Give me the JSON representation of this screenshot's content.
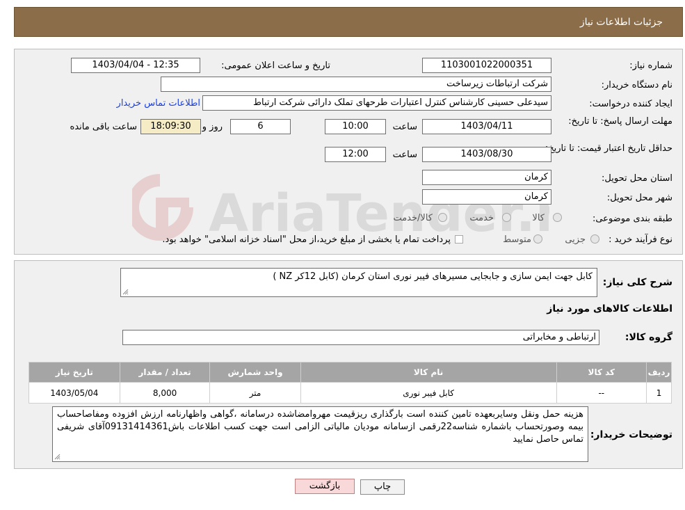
{
  "header": {
    "title": "جزئیات اطلاعات نیاز"
  },
  "form": {
    "need_number_label": "شماره نیاز:",
    "need_number": "1103001022000351",
    "announce_label": "تاریخ و ساعت اعلان عمومی:",
    "announce_value": "1403/04/04 - 12:35",
    "buyer_org_label": "نام دستگاه خریدار:",
    "buyer_org": "شرکت ارتباطات زیرساخت",
    "requester_label": "ایجاد کننده درخواست:",
    "requester": "سیدعلی حسینی کارشناس کنترل اعتبارات طرحهای تملک دارائی شرکت ارتباط",
    "buyer_contact_link": "اطلاعات تماس خریدار",
    "deadline_label": "مهلت ارسال پاسخ: تا تاریخ:",
    "deadline_date": "1403/04/11",
    "time_label": "ساعت",
    "deadline_time": "10:00",
    "days_value": "6",
    "days_label": "روز و",
    "remaining_time": "18:09:30",
    "remaining_label": "ساعت باقی مانده",
    "validity_label": "حداقل تاریخ اعتبار قیمت: تا تاریخ:",
    "validity_date": "1403/08/30",
    "validity_time": "12:00",
    "province_label": "استان محل تحویل:",
    "province": "کرمان",
    "city_label": "شهر محل تحویل:",
    "city": "کرمان",
    "category_label": "طبقه بندی موضوعی:",
    "category_options": [
      "کالا",
      "خدمت",
      "کالا/خدمت"
    ],
    "process_label": "نوع فرآیند خرید :",
    "process_options": [
      "جزیی",
      "متوسط"
    ],
    "payment_note": "پرداخت تمام یا بخشی از مبلغ خرید،از محل \"اسناد خزانه اسلامی\" خواهد بود."
  },
  "summary": {
    "label": "شرح کلی نیاز:",
    "value": "کابل جهت ایمن سازی و جابجایی مسیرهای فیبر نوری استان کرمان (کابل 12کر NZ )"
  },
  "goods_info": {
    "title": "اطلاعات کالاهای مورد نیاز",
    "group_label": "گروه کالا:",
    "group_value": "ارتباطی و مخابراتی"
  },
  "table": {
    "headers": [
      "ردیف",
      "کد کالا",
      "نام کالا",
      "واحد شمارش",
      "تعداد / مقدار",
      "تاریخ نیاز"
    ],
    "rows": [
      [
        "1",
        "--",
        "کابل فیبر نوری",
        "متر",
        "8,000",
        "1403/05/04"
      ]
    ]
  },
  "notes": {
    "label": "توضیحات خریدار:",
    "value": "هزینه حمل ونقل وسایربعهده تامین کننده است بارگذاری ریزقیمت مهروامضاشده درسامانه ،گواهی واظهارنامه ارزش افزوده ومفاصاحساب بیمه وصورتحساب باشماره شناسه22رقمی ازسامانه مودیان مالیاتی الزامی است جهت کسب اطلاعات باش09131414361آقای شریفی تماس حاصل نمایید"
  },
  "buttons": {
    "print": "چاپ",
    "back": "بازگشت"
  },
  "watermark": {
    "text": "AriaTender.neT"
  },
  "colors": {
    "header_bg": "#8c6d4a",
    "table_header_bg": "#a5a5a5",
    "link": "#1a3ee0",
    "back_button_bg": "#f8d8d8"
  }
}
